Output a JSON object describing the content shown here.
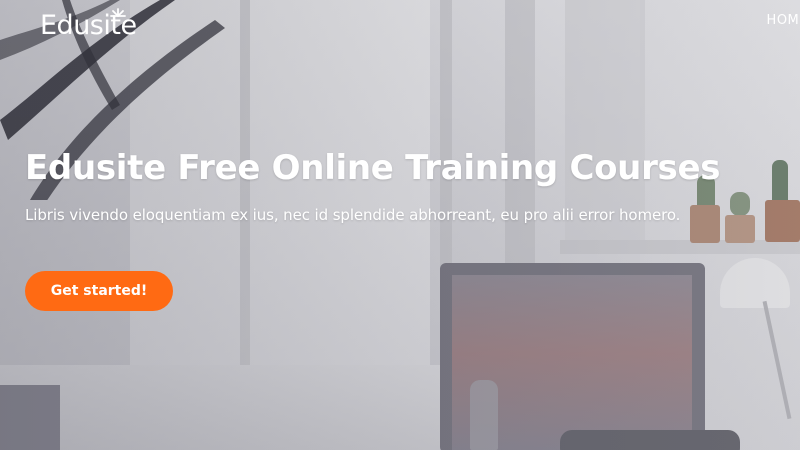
{
  "brand": {
    "name": "Edusite",
    "logo_icon": "sunburst-icon"
  },
  "nav": {
    "items": [
      {
        "label": "HOME"
      }
    ]
  },
  "hero": {
    "title": "Edusite Free Online Training Courses",
    "subtitle": "Libris vivendo eloquentiam ex ius, nec id splendide abhorreant, eu pro alii error homero.",
    "cta_label": "Get started!"
  },
  "colors": {
    "accent": "#ff6a13",
    "text_on_hero": "#ffffff"
  }
}
